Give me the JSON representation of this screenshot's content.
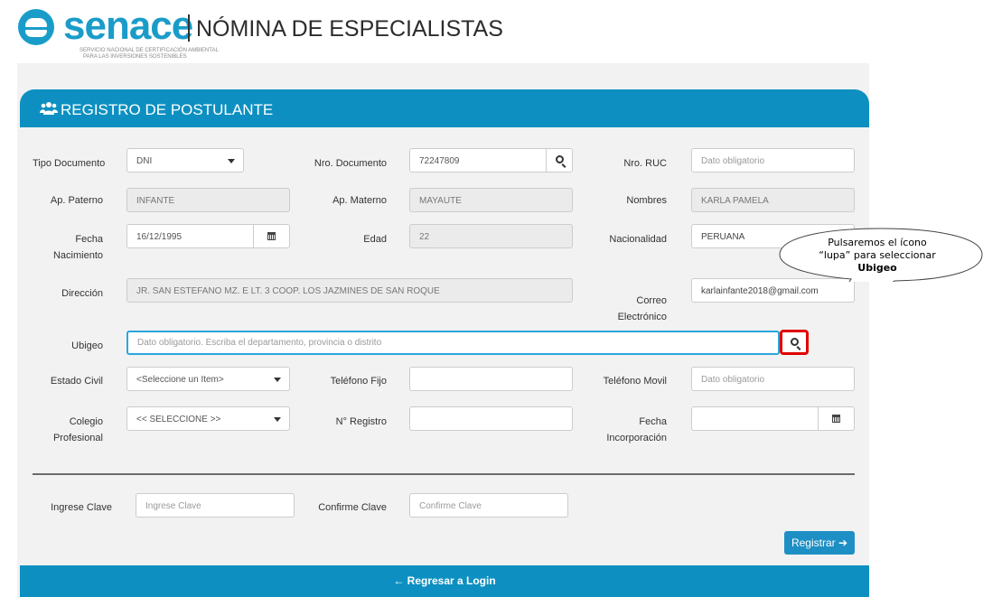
{
  "brand": {
    "name": "senace",
    "title": "NÓMINA DE ESPECIALISTAS",
    "subtitle_line1": "SERVICIO NACIONAL DE CERTIFICACIÓN AMBIENTAL",
    "subtitle_line2": "PARA LAS INVERSIONES SOSTENIBLES",
    "color": "#1a9cc9"
  },
  "panel": {
    "title": "REGISTRO DE POSTULANTE",
    "title_icon": "users-icon",
    "accent_color": "#0d90c1"
  },
  "form": {
    "tipo_documento": {
      "label": "Tipo Documento",
      "value": "DNI"
    },
    "nro_documento": {
      "label": "Nro. Documento",
      "value": "72247809"
    },
    "nro_ruc": {
      "label": "Nro. RUC",
      "placeholder": "Dato obligatorio"
    },
    "ap_paterno": {
      "label": "Ap. Paterno",
      "value": "INFANTE"
    },
    "ap_materno": {
      "label": "Ap. Materno",
      "value": "MAYAUTE"
    },
    "nombres": {
      "label": "Nombres",
      "value": "KARLA PAMELA"
    },
    "fecha_nacimiento": {
      "label_line1": "Fecha",
      "label_line2": "Nacimiento",
      "value": "16/12/1995"
    },
    "edad": {
      "label": "Edad",
      "value": "22"
    },
    "nacionalidad": {
      "label": "Nacionalidad",
      "value": "PERUANA"
    },
    "direccion": {
      "label": "Dirección",
      "value": "JR. SAN ESTEFANO MZ. E LT. 3 COOP. LOS JAZMINES DE SAN ROQUE"
    },
    "correo": {
      "label_line1": "Correo",
      "label_line2": "Electrónico",
      "value": "karlainfante2018@gmail.com"
    },
    "ubigeo": {
      "label": "Ubigeo",
      "placeholder": "Dato obligatorio. Escriba el departamento, provincia o distrito"
    },
    "estado_civil": {
      "label": "Estado Civil",
      "value": "<Seleccione un Item>"
    },
    "telefono_fijo": {
      "label": "Teléfono Fijo",
      "value": ""
    },
    "telefono_movil": {
      "label": "Teléfono Movil",
      "placeholder": "Dato obligatorio"
    },
    "colegio_profesional": {
      "label_line1": "Colegio",
      "label_line2": "Profesional",
      "value": "<< SELECCIONE >>"
    },
    "nro_registro": {
      "label": "N° Registro",
      "value": ""
    },
    "fecha_incorporacion": {
      "label_line1": "Fecha",
      "label_line2": "Incorporación",
      "value": ""
    },
    "clave": {
      "label": "Ingrese Clave",
      "placeholder": "Ingrese Clave"
    },
    "confirme_clave": {
      "label": "Confirme Clave",
      "placeholder": "Confirme Clave"
    }
  },
  "actions": {
    "registrar_label": "Registrar ➔",
    "regresar_label": "← Regresar a Login"
  },
  "callout": {
    "line1": "Pulsaremos el ícono",
    "line2": "“lupa” para seleccionar",
    "line3": "Ubigeo",
    "highlight_color": "#e00000"
  }
}
